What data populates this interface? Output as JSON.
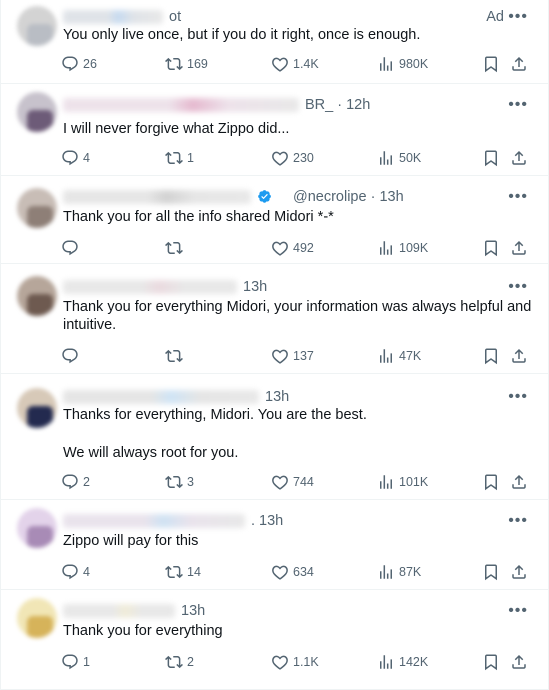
{
  "ad_label": "Ad",
  "more_glyph": "•••",
  "colors": {
    "text": "#0f1419",
    "secondary": "#536471",
    "verified": "#1d9bf0",
    "divider": "#eff3f4"
  },
  "tweets": [
    {
      "handle_tail": "ot",
      "text": [
        "You only live once, but if you do it right, once is enough."
      ],
      "replies": "26",
      "reposts": "169",
      "likes": "1.4K",
      "views": "980K"
    },
    {
      "handle_tail": "BR_ · 12h",
      "text": [
        "I will never forgive what Zippo did..."
      ],
      "replies": "4",
      "reposts": "1",
      "likes": "230",
      "views": "50K"
    },
    {
      "handle_tail": "@necrolipe · 13h",
      "text": [
        "Thank you for all the info shared Midori *-*"
      ],
      "replies": "",
      "reposts": "",
      "likes": "492",
      "views": "109K"
    },
    {
      "handle_tail": "13h",
      "text": [
        "Thank you for everything Midori, your information was always helpful and intuitive."
      ],
      "replies": "",
      "reposts": "",
      "likes": "137",
      "views": "47K"
    },
    {
      "handle_tail": "13h",
      "text": [
        "Thanks for everything, Midori. You are the best.",
        "We will always root for you."
      ],
      "replies": "2",
      "reposts": "3",
      "likes": "744",
      "views": "101K"
    },
    {
      "handle_tail": ". 13h",
      "text": [
        "Zippo will pay for this"
      ],
      "replies": "4",
      "reposts": "14",
      "likes": "634",
      "views": "87K"
    },
    {
      "handle_tail": "13h",
      "text": [
        "Thank you for everything"
      ],
      "replies": "1",
      "reposts": "2",
      "likes": "1.1K",
      "views": "142K"
    }
  ]
}
